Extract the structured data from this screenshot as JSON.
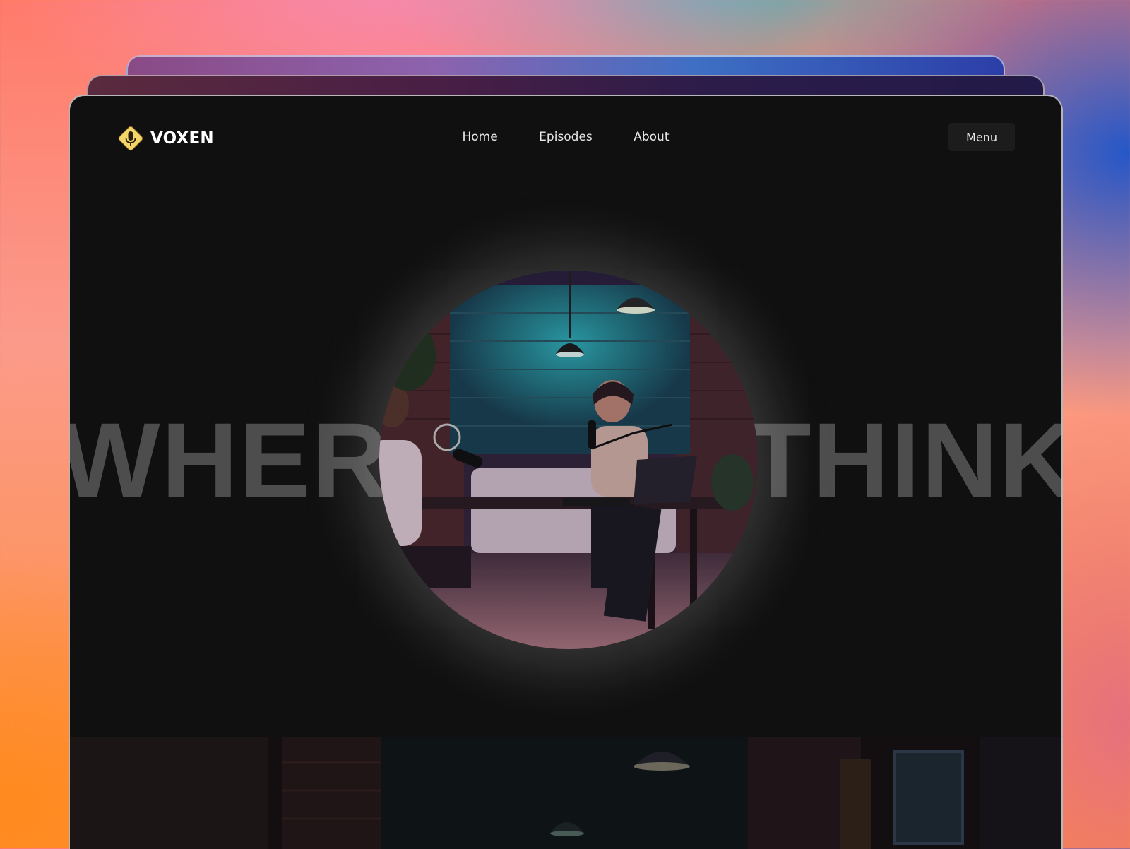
{
  "app": {
    "brand": "VOXEN"
  },
  "nav": {
    "links": [
      "Home",
      "Episodes",
      "About"
    ],
    "menu_label": "Menu"
  },
  "hero": {
    "word_left": "WHERE",
    "word_right": "THINKE"
  },
  "colors": {
    "window_bg": "#101010",
    "logo_badge": "#f2d66a",
    "text_muted": "#4d4d4d"
  },
  "icons": {
    "logo": "microphone-badge-icon"
  }
}
